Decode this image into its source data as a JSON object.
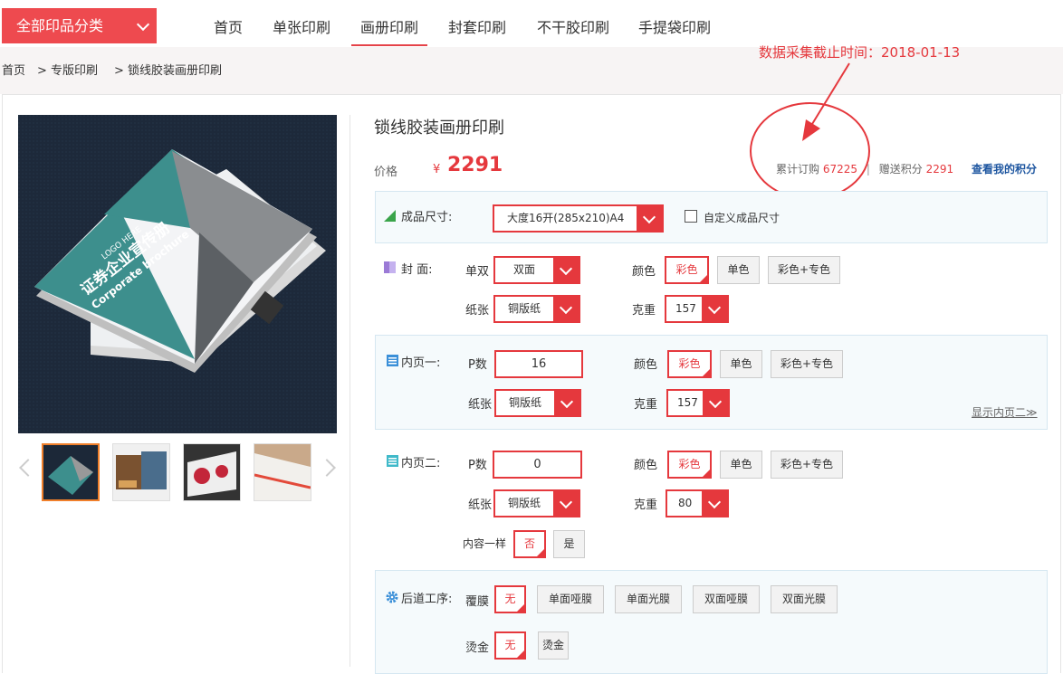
{
  "nav": {
    "category_button": "全部印品分类",
    "items": [
      "首页",
      "单张印刷",
      "画册印刷",
      "封套印刷",
      "不干胶印刷",
      "手提袋印刷"
    ],
    "active_index": 2
  },
  "breadcrumb": [
    "首页",
    "> 专版印刷",
    "> 锁线胶装画册印刷"
  ],
  "annotation": "数据采集截止时间：2018-01-13",
  "product": {
    "title": "锁线胶装画册印刷",
    "price_label": "价格",
    "currency": "¥",
    "price": "2291",
    "orders_label": "累计订购",
    "orders": "67225",
    "divider": "|",
    "points_label": "赠送积分",
    "points": "2291",
    "my_points_link": "查看我的积分"
  },
  "image_art": {
    "logo": "LOGO HERE",
    "headline": "证券企业宣传册",
    "subtitle": "Corporate brochure"
  },
  "size_section": {
    "label": "成品尺寸:",
    "value": "大度16开(285x210)A4",
    "custom_label": "自定义成品尺寸"
  },
  "cover": {
    "label": "封  面:",
    "side_label": "单双",
    "side_value": "双面",
    "color_label": "颜色",
    "color_options": [
      "彩色",
      "单色",
      "彩色+专色"
    ],
    "paper_label": "纸张",
    "paper_value": "铜版纸",
    "weight_label": "克重",
    "weight_value": "157"
  },
  "inner1": {
    "label": "内页一:",
    "p_label": "P数",
    "p_value": "16",
    "color_label": "颜色",
    "color_options": [
      "彩色",
      "单色",
      "彩色+专色"
    ],
    "paper_label": "纸张",
    "paper_value": "铜版纸",
    "weight_label": "克重",
    "weight_value": "157",
    "toggle_link": "显示内页二≫"
  },
  "inner2": {
    "label": "内页二:",
    "p_label": "P数",
    "p_value": "0",
    "color_label": "颜色",
    "color_options": [
      "彩色",
      "单色",
      "彩色+专色"
    ],
    "paper_label": "纸张",
    "paper_value": "铜版纸",
    "weight_label": "克重",
    "weight_value": "80",
    "same_label": "内容一样",
    "same_options": [
      "否",
      "是"
    ]
  },
  "post": {
    "label": "后道工序:",
    "film_label": "覆膜",
    "film_options": [
      "无",
      "单面哑膜",
      "单面光膜",
      "双面哑膜",
      "双面光膜"
    ],
    "foil_label": "烫金",
    "foil_options": [
      "无",
      "烫金"
    ]
  },
  "colors": {
    "accent": "#e5383d",
    "nav_red": "#ee4a4f",
    "panel_bg": "#f5fafc",
    "link_blue": "#1e56a0"
  }
}
